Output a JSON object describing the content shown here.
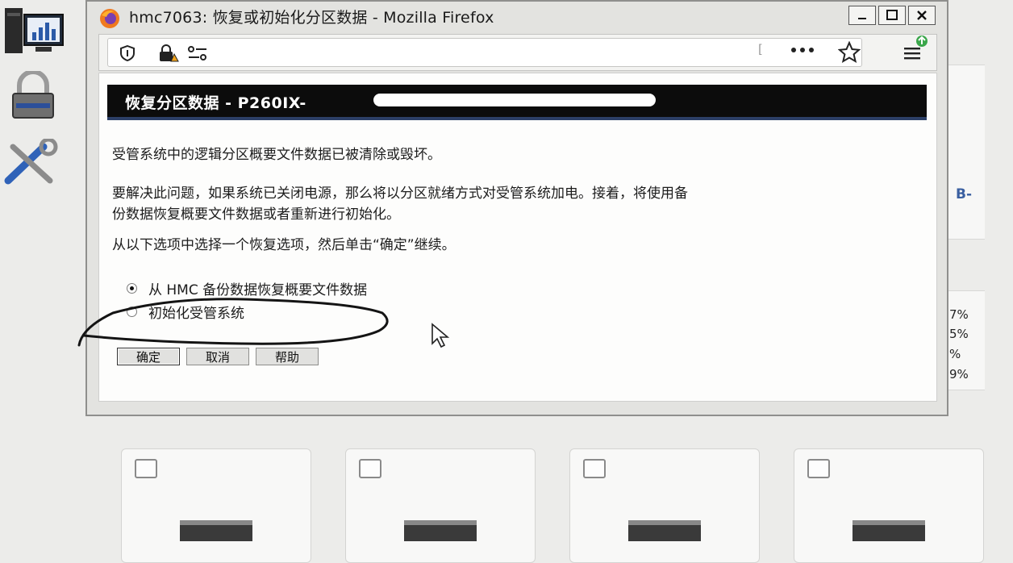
{
  "window": {
    "title": "hmc7063: 恢复或初始化分区数据 - Mozilla Firefox",
    "minimize_icon": "minimize-icon",
    "maximize_icon": "maximize-icon",
    "close_icon": "close-icon"
  },
  "navbar": {
    "url_fragment": "[",
    "icons": [
      "shield-icon",
      "lock-warning-icon",
      "permissions-icon",
      "more-icon",
      "bookmark-star-icon",
      "menu-update-icon"
    ]
  },
  "dialog": {
    "banner_title": "恢复分区数据 - P260IX-",
    "para1": "受管系统中的逻辑分区概要文件数据已被清除或毁坏。",
    "para2_line1": "要解决此问题，如果系统已关闭电源，那么将以分区就绪方式对受管系统加电。接着，将使用备",
    "para2_line2": "份数据恢复概要文件数据或者重新进行初始化。",
    "para3": "从以下选项中选择一个恢复选项，然后单击“确定”继续。",
    "options": [
      {
        "label": "从 HMC 备份数据恢复概要文件数据",
        "selected": true
      },
      {
        "label": "初始化受管系统",
        "selected": false
      }
    ],
    "buttons": {
      "ok": "确定",
      "cancel": "取消",
      "help": "帮助"
    }
  },
  "background": {
    "right_fragment": "B-",
    "pct_fragments": [
      "7%",
      "5%",
      "%",
      "9%"
    ]
  },
  "colors": {
    "banner": "#0c0c0c",
    "banner_underline": "#2c3f67",
    "link_blue": "#3a5fa0"
  }
}
